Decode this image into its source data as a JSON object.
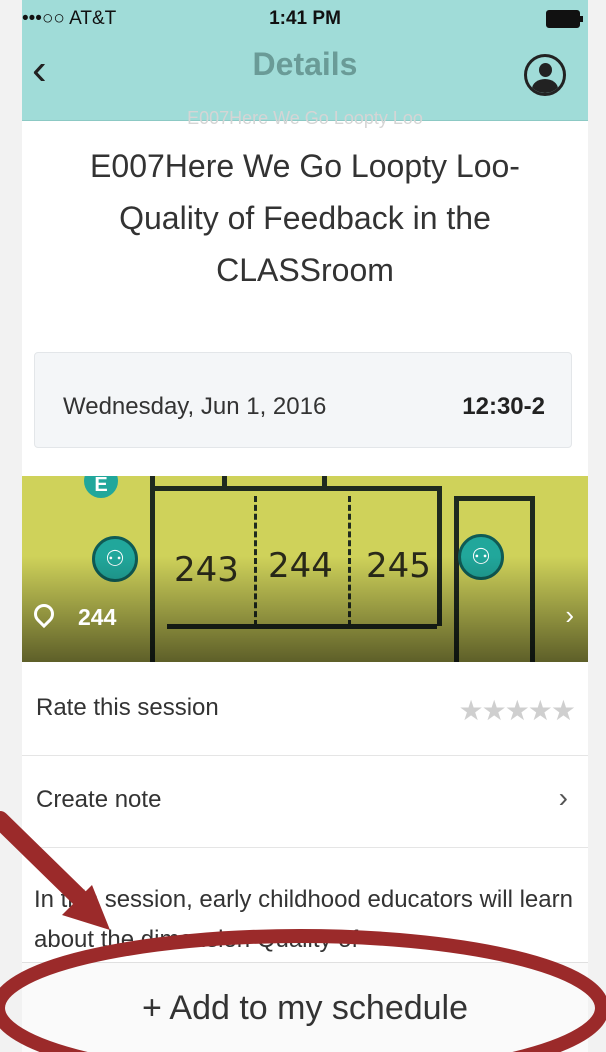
{
  "status_bar": {
    "carrier": "•••○○ AT&T",
    "time": "1:41 PM"
  },
  "nav": {
    "title": "Details",
    "back_icon": "chevron-left-icon",
    "profile_icon": "user-icon"
  },
  "ghost_text": "E007Here We Go Loopty Loo",
  "session": {
    "title": "E007Here We Go Loopty Loo-Quality of Feedback in the CLASSroom",
    "date": "Wednesday, Jun 1, 2016",
    "time": "12:30-2"
  },
  "map": {
    "rooms": [
      "243",
      "244",
      "245"
    ],
    "location": "244",
    "badge": "E"
  },
  "rows": {
    "rate_label": "Rate this session",
    "rating": 0,
    "note_label": "Create note"
  },
  "description": "In this session, early childhood educators will learn about the dimension Quality of",
  "add_button": {
    "label": "+ Add to my schedule"
  },
  "colors": {
    "nav_bg": "#a0dcd8",
    "annotation": "#9b2a2a",
    "accent": "#21a79b"
  }
}
